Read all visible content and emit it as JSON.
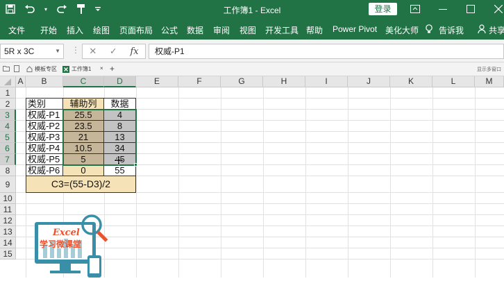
{
  "titlebar": {
    "title": "工作簿1 - Excel",
    "login_label": "登录"
  },
  "tabs": [
    "文件",
    "开始",
    "插入",
    "绘图",
    "页面布局",
    "公式",
    "数据",
    "审阅",
    "视图",
    "开发工具",
    "帮助",
    "Power Pivot",
    "美化大师",
    "告诉我",
    "共享"
  ],
  "formula_bar": {
    "name_box": "5R x 3C",
    "formula": "权威-P1",
    "fx_label": "fx"
  },
  "workbook_tabs": {
    "template_tab": "模板专区",
    "workbook_tab": "工作簿1",
    "add_label": "+",
    "right_label": "显示多窗口"
  },
  "columns": [
    "A",
    "B",
    "C",
    "D",
    "E",
    "F",
    "G",
    "H",
    "I",
    "J",
    "K",
    "L",
    "M"
  ],
  "rows": [
    "1",
    "2",
    "3",
    "4",
    "5",
    "6",
    "7",
    "8",
    "9",
    "10",
    "11",
    "12",
    "13",
    "14",
    "15"
  ],
  "table": {
    "headers": [
      "类别",
      "辅助列",
      "数据"
    ],
    "rows": [
      [
        "权威-P1",
        "25.5",
        "4"
      ],
      [
        "权威-P2",
        "23.5",
        "8"
      ],
      [
        "权威-P3",
        "21",
        "13"
      ],
      [
        "权威-P4",
        "10.5",
        "34"
      ],
      [
        "权威-P5",
        "5",
        "45"
      ],
      [
        "权威-P6",
        "0",
        "55"
      ]
    ],
    "note": "C3=(55-D3)/2"
  },
  "logo": {
    "text_en": "Excel",
    "text_cn": "学习微课堂"
  },
  "colors": {
    "excel_green": "#217346",
    "header_fill": "#f5e3b7",
    "selected_fill": "#c5b69a",
    "data_fill": "#c3c3c3"
  }
}
